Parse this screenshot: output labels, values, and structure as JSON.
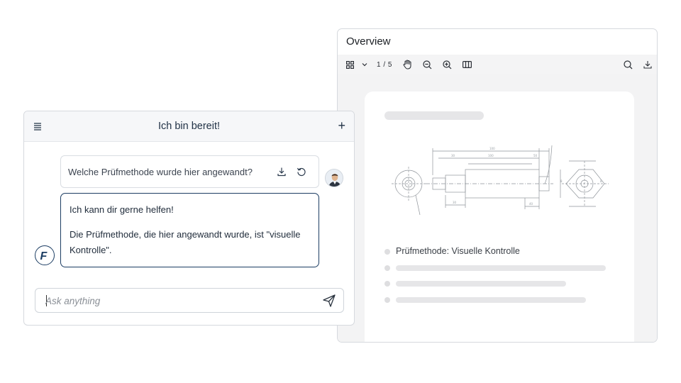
{
  "viewer": {
    "title": "Overview",
    "toolbar": {
      "grid_icon": "grid-view-icon",
      "dropdown_icon": "chevron-down-icon",
      "page_indicator": "1 / 5",
      "pan_icon": "hand-pan-icon",
      "zoom_out_icon": "zoom-out-icon",
      "zoom_in_icon": "zoom-in-icon",
      "columns_icon": "two-page-view-icon",
      "search_icon": "search-icon",
      "download_icon": "download-icon"
    },
    "document": {
      "result_line": "Prüfmethode: Visuelle Kontrolle"
    }
  },
  "chat": {
    "title": "Ich bin bereit!",
    "menu_icon": "menu-icon",
    "new_chat_label": "+",
    "user_message": "Welche Prüfmethode wurde hier angewandt?",
    "bot_messages": [
      "Ich kann dir gerne helfen!",
      "Die Prüfmethode, die hier angewandt wurde, ist \"visuelle Kontrolle\"."
    ],
    "bot_logo_letter": "F",
    "composer": {
      "placeholder": "Ask anything"
    }
  },
  "colors": {
    "accent": "#1c3d63",
    "skeleton": "#e6e6e8",
    "toolbar_bg": "#f4f4f5"
  }
}
